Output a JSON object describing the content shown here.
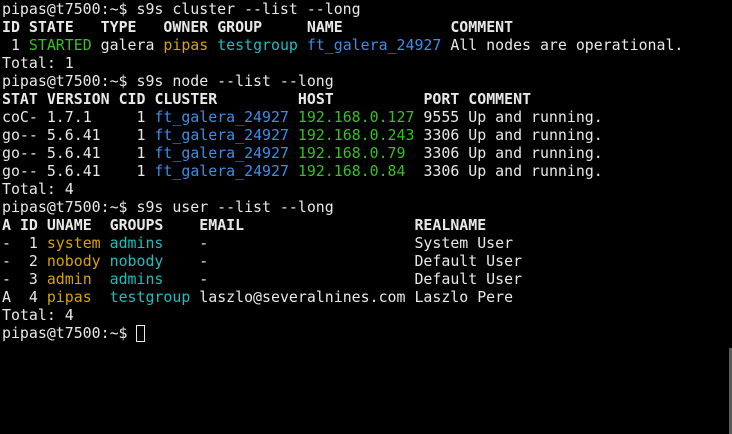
{
  "colors": {
    "background": "#000000",
    "text": "#e8e8e8",
    "green": "#35c11e",
    "yellow": "#d8a300",
    "cyan": "#1bbfbf",
    "blue": "#3b8eea"
  },
  "prompt": "pipas@t7500:~$ ",
  "cluster": {
    "command": "s9s cluster --list --long",
    "header": {
      "id": "ID",
      "state": "STATE",
      "type": "TYPE",
      "owner": "OWNER",
      "group": "GROUP",
      "name": "NAME",
      "comment": "COMMENT"
    },
    "row": {
      "id": "1",
      "state": "STARTED",
      "type": "galera",
      "owner": "pipas",
      "group": "testgroup",
      "name": "ft_galera_24927",
      "comment": "All nodes are operational."
    },
    "total": "Total: 1"
  },
  "node": {
    "command": "s9s node --list --long",
    "header": {
      "stat": "STAT",
      "version": "VERSION",
      "cid": "CID",
      "cluster": "CLUSTER",
      "host": "HOST",
      "port": "PORT",
      "comment": "COMMENT"
    },
    "rows": [
      {
        "stat": "coC-",
        "version": "1.7.1",
        "cid": "1",
        "cluster": "ft_galera_24927",
        "host": "192.168.0.127",
        "port": "9555",
        "comment": "Up and running."
      },
      {
        "stat": "go--",
        "version": "5.6.41",
        "cid": "1",
        "cluster": "ft_galera_24927",
        "host": "192.168.0.243",
        "port": "3306",
        "comment": "Up and running."
      },
      {
        "stat": "go--",
        "version": "5.6.41",
        "cid": "1",
        "cluster": "ft_galera_24927",
        "host": "192.168.0.79",
        "port": "3306",
        "comment": "Up and running."
      },
      {
        "stat": "go--",
        "version": "5.6.41",
        "cid": "1",
        "cluster": "ft_galera_24927",
        "host": "192.168.0.84",
        "port": "3306",
        "comment": "Up and running."
      }
    ],
    "total": "Total: 4"
  },
  "user": {
    "command": "s9s user --list --long",
    "header": {
      "a": "A",
      "id": "ID",
      "uname": "UNAME",
      "groups": "GROUPS",
      "email": "EMAIL",
      "realname": "REALNAME"
    },
    "rows": [
      {
        "a": "-",
        "id": "1",
        "uname": "system",
        "groups": "admins",
        "email": "-",
        "realname": "System User"
      },
      {
        "a": "-",
        "id": "2",
        "uname": "nobody",
        "groups": "nobody",
        "email": "-",
        "realname": "Default User"
      },
      {
        "a": "-",
        "id": "3",
        "uname": "admin",
        "groups": "admins",
        "email": "-",
        "realname": "Default User"
      },
      {
        "a": "A",
        "id": "4",
        "uname": "pipas",
        "groups": "testgroup",
        "email": "laszlo@severalnines.com",
        "realname": "Laszlo Pere"
      }
    ],
    "total": "Total: 4"
  }
}
